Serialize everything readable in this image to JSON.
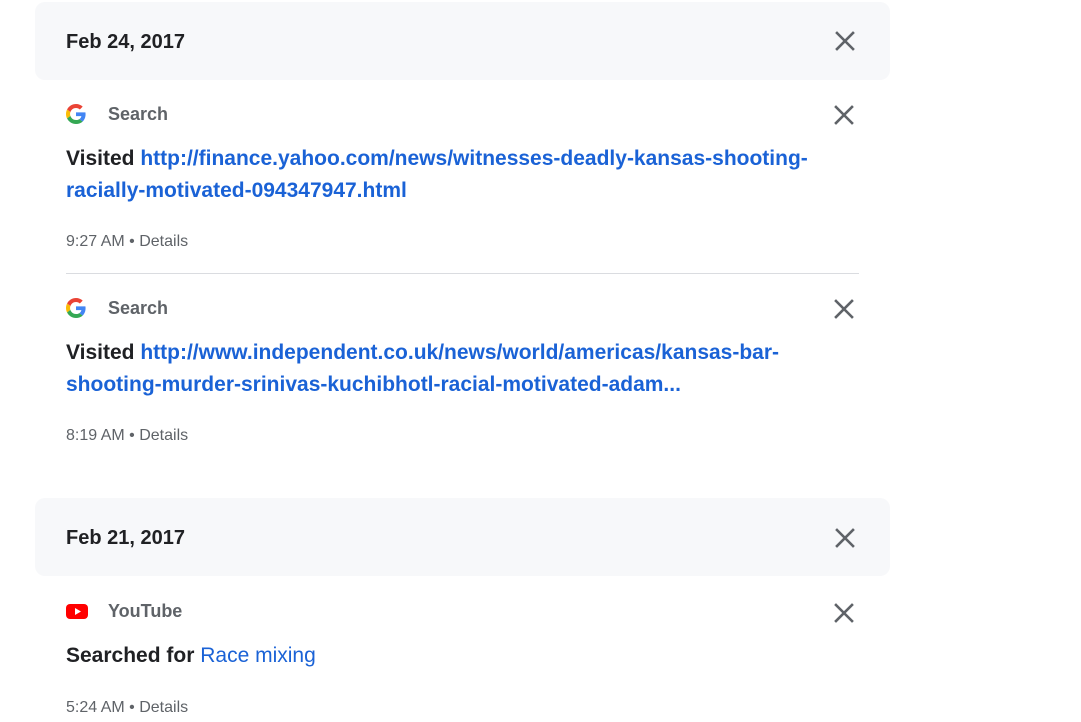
{
  "groups": [
    {
      "date": "Feb 24, 2017",
      "items": [
        {
          "product": "Search",
          "prefix": "Visited",
          "link": "http://finance.yahoo.com/news/witnesses-deadly-kansas-shooting-racially-motivated-094347947.html",
          "time": "9:27 AM",
          "details": "Details"
        },
        {
          "product": "Search",
          "prefix": "Visited",
          "link": "http://www.independent.co.uk/news/world/americas/kansas-bar-shooting-murder-srinivas-kuchibhotl-racial-motivated-adam...",
          "time": "8:19 AM",
          "details": "Details"
        }
      ]
    },
    {
      "date": "Feb 21, 2017",
      "items": [
        {
          "product": "YouTube",
          "prefix": "Searched for",
          "link": "Race mixing",
          "time": "5:24 AM",
          "details": "Details"
        }
      ]
    }
  ],
  "separator": "•",
  "icons": {
    "search": "google-g-icon",
    "youtube": "youtube-icon",
    "delete": "close-icon"
  },
  "colors": {
    "link": "#1a62d6",
    "header_bg": "#f7f8fa",
    "youtube_red": "#ff0000"
  }
}
